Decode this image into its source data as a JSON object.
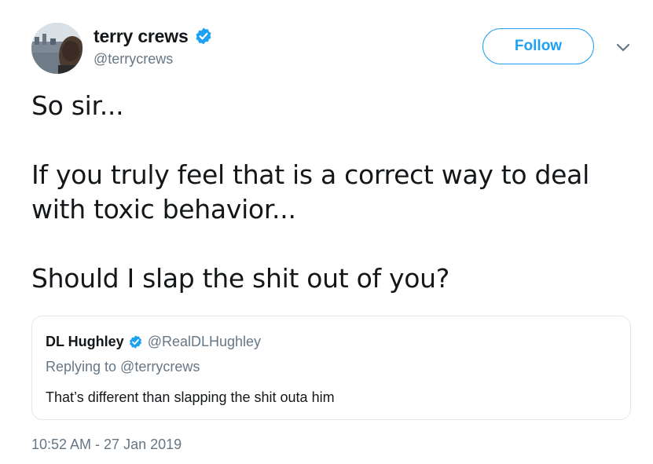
{
  "author": {
    "name": "terry crews",
    "handle": "@terrycrews",
    "verified": true,
    "avatar_icon": "avatar-photo"
  },
  "actions": {
    "follow_label": "Follow",
    "menu_icon": "chevron-down-icon"
  },
  "tweet": {
    "paragraphs": [
      "So sir...",
      "If you truly feel that is a correct way to deal with toxic behavior...",
      "Should I slap the shit out of you?"
    ],
    "timestamp": "10:52 AM - 27 Jan 2019"
  },
  "quoted_tweet": {
    "name": "DL Hughley",
    "handle": "@RealDLHughley",
    "verified": true,
    "replying_to": "Replying to @terrycrews",
    "text": "That’s different than slapping the shit outa him"
  },
  "colors": {
    "accent": "#1da1f2",
    "text_primary": "#14171a",
    "text_secondary": "#657786",
    "border": "#e1e8ed"
  }
}
